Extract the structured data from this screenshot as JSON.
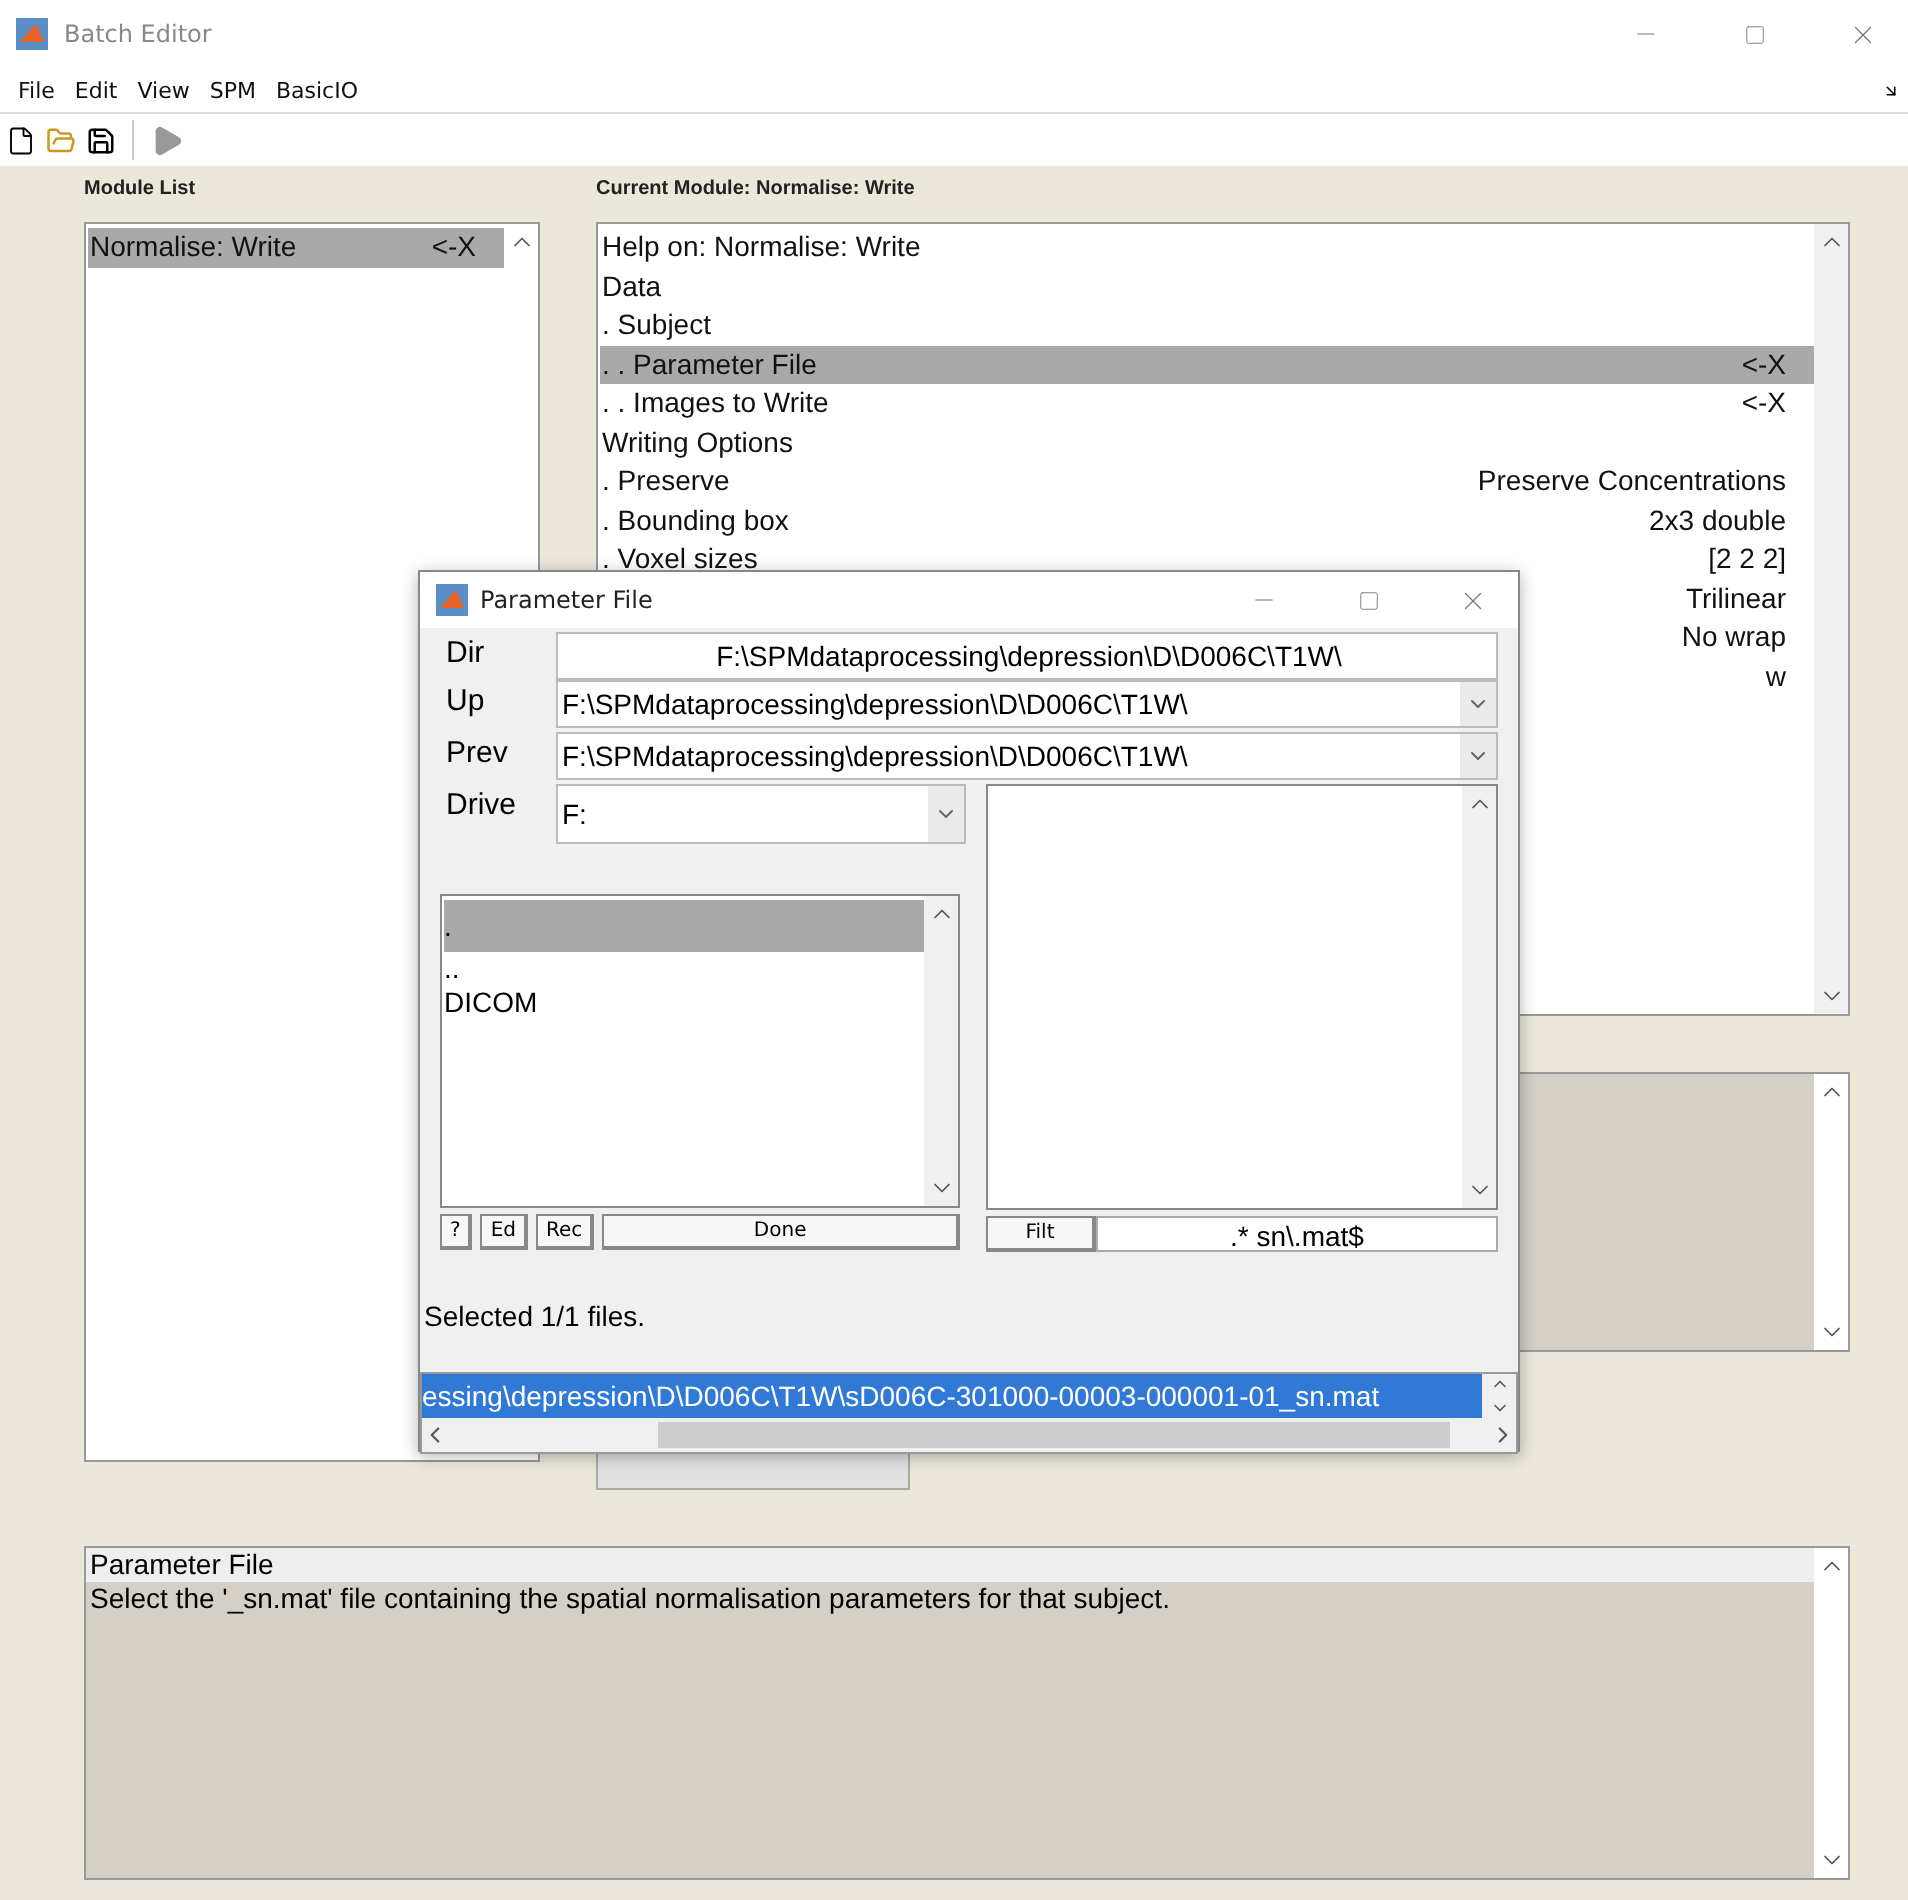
{
  "window": {
    "title": "Batch Editor"
  },
  "menu": [
    "File",
    "Edit",
    "View",
    "SPM",
    "BasicIO"
  ],
  "module_list": {
    "heading": "Module List",
    "items": [
      {
        "name": "Normalise: Write",
        "marker": "<-X",
        "selected": true
      }
    ]
  },
  "current_module": {
    "heading": "Current Module: Normalise: Write",
    "rows": [
      {
        "label": "Help on: Normalise: Write",
        "selected": false
      },
      {
        "label": "Data",
        "selected": false
      },
      {
        "label": ". Subject",
        "selected": false
      },
      {
        "label": ". . Parameter File",
        "value": "<-X",
        "selected": true
      },
      {
        "label": ". . Images to Write",
        "value": "<-X",
        "selected": false
      },
      {
        "label": "Writing Options",
        "selected": false
      },
      {
        "label": ". Preserve",
        "value": "Preserve Concentrations",
        "selected": false
      },
      {
        "label": ". Bounding box",
        "value": "2x3 double",
        "selected": false
      },
      {
        "label": ". Voxel sizes",
        "value": "[2 2 2]",
        "selected": false
      },
      {
        "value": "Trilinear",
        "selected": false
      },
      {
        "value": "No wrap",
        "selected": false
      },
      {
        "value": "w",
        "selected": false
      }
    ]
  },
  "help": {
    "title": "Parameter File",
    "text": "Select the '_sn.mat' file containing the spatial normalisation parameters for that subject."
  },
  "dialog": {
    "title": "Parameter File",
    "dir_label": "Dir",
    "dir": "F:\\SPMdataprocessing\\depression\\D\\D006C\\T1W\\",
    "up_label": "Up",
    "up": "F:\\SPMdataprocessing\\depression\\D\\D006C\\T1W\\",
    "prev_label": "Prev",
    "prev": "F:\\SPMdataprocessing\\depression\\D\\D006C\\T1W\\",
    "drive_label": "Drive",
    "drive": "F:",
    "folders": [
      {
        "name": ".",
        "selected": true
      },
      {
        "name": "..",
        "selected": false
      },
      {
        "name": "DICOM",
        "selected": false
      }
    ],
    "buttons": [
      "?",
      "Ed",
      "Rec"
    ],
    "done_button": "Done",
    "filter_button": "Filt",
    "filter": ".*  sn\\.mat$",
    "status": "Selected 1/1 files.",
    "selected_files": [
      {
        "path": "essing\\depression\\D\\D006C\\T1W\\sD006C-301000-00003-000001-01_sn.mat",
        "selected": true
      }
    ]
  }
}
